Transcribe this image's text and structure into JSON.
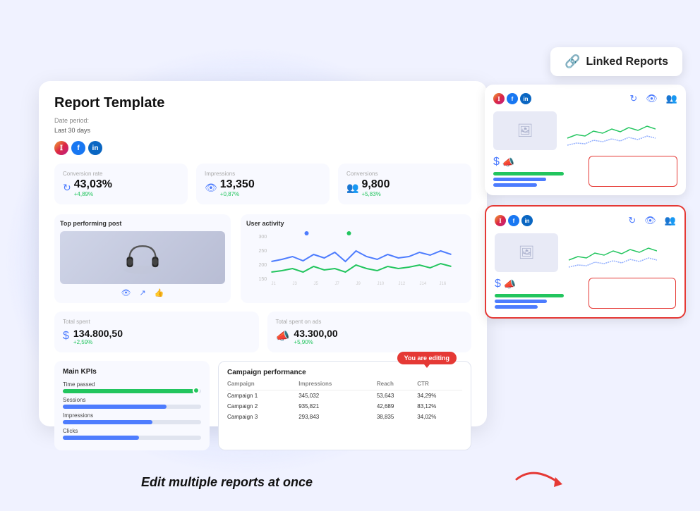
{
  "linked_reports_btn": {
    "label": "Linked Reports",
    "icon": "🔗"
  },
  "report_card": {
    "title": "Report Template",
    "date_period_label": "Date period:",
    "date_period_value": "Last 30 days",
    "social_icons": [
      "instagram",
      "facebook",
      "linkedin"
    ],
    "metrics": [
      {
        "label": "Conversion rate",
        "value": "43,03%",
        "change": "+4,89%",
        "icon": "sync"
      },
      {
        "label": "Impressions",
        "value": "13,350",
        "change": "+0,87%",
        "icon": "eye"
      },
      {
        "label": "Conversions",
        "value": "9,800",
        "change": "+5,83%",
        "icon": "users"
      }
    ],
    "top_post_label": "Top performing post",
    "user_activity_label": "User activity",
    "finance": [
      {
        "label": "Total spent",
        "value": "134.800,50",
        "change": "+2,59%",
        "icon": "$"
      },
      {
        "label": "Total spent on ads",
        "value": "43.300,00",
        "change": "+5,90%",
        "icon": "📣"
      }
    ],
    "kpi": {
      "title": "Main KPIs",
      "items": [
        {
          "name": "Time passed",
          "fill": 95,
          "color": "green"
        },
        {
          "name": "Sessions",
          "fill": 75,
          "color": "blue"
        },
        {
          "name": "Impressions",
          "fill": 65,
          "color": "blue"
        },
        {
          "name": "Clicks",
          "fill": 55,
          "color": "blue"
        }
      ]
    },
    "campaign": {
      "title": "Campaign performance",
      "editing_badge": "You are editing",
      "columns": [
        "Campaign",
        "Impressions",
        "Reach",
        "CTR"
      ],
      "rows": [
        [
          "Campaign 1",
          "345,032",
          "53,643",
          "34,29%"
        ],
        [
          "Campaign 2",
          "935,821",
          "42,689",
          "83,12%"
        ],
        [
          "Campaign 3",
          "293,843",
          "38,835",
          "34,02%"
        ]
      ]
    }
  },
  "linked_cards": [
    {
      "id": 1,
      "has_highlight": false
    },
    {
      "id": 2,
      "has_highlight": true
    }
  ],
  "bottom_text": "Edit multiple reports at once",
  "colors": {
    "accent_blue": "#4d7cfe",
    "accent_red": "#e53935",
    "accent_green": "#22c55e"
  }
}
